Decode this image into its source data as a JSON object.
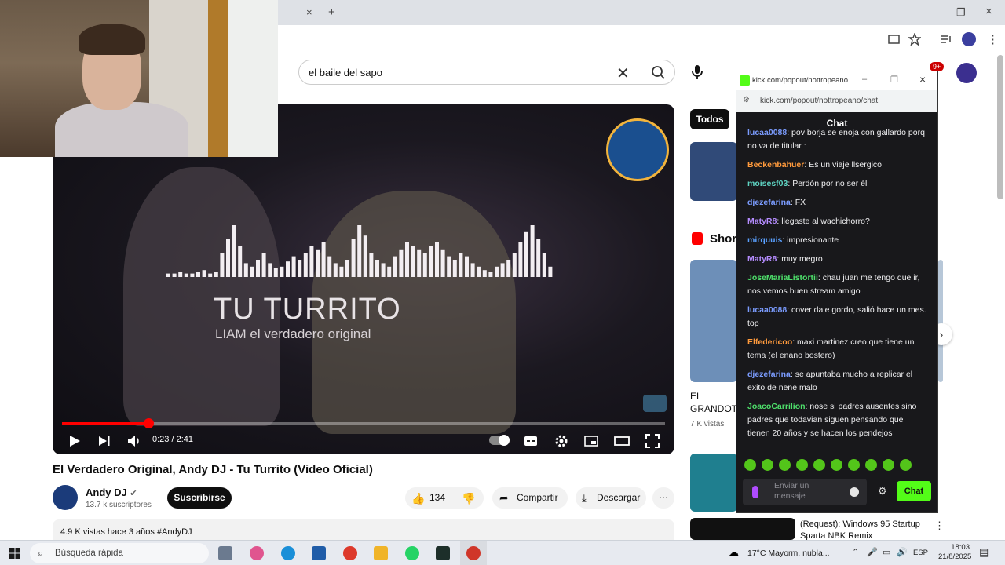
{
  "browser": {
    "tab_close": "×",
    "tab_new": "+",
    "window_min": "–",
    "window_restore": "❐",
    "window_close": "×"
  },
  "youtube": {
    "search": {
      "value": "el baile del sapo"
    },
    "player": {
      "song_title": "TU TURRITO",
      "song_subtitle": "LIAM el verdadero original",
      "time": "0:23 / 2:41",
      "progress": 0.143
    },
    "video": {
      "title": "El Verdadero Original, Andy DJ - Tu Turrito (Video Oficial)",
      "channel": "Andy DJ",
      "subscribers": "13.7 k suscriptores",
      "subscribe_label": "Suscribirse",
      "likes": "134",
      "share_label": "Compartir",
      "download_label": "Descargar",
      "description": "4.9 K vistas  hace 3 años  #AndyDJ"
    },
    "sidebar": {
      "chip_all": "Todos",
      "shorts_label": "Shor",
      "short_title_1": "EL",
      "short_title_2": "GRANDOT",
      "short_views": "7 K vistas",
      "rec_title_1": "(Request): Windows 95 Startup",
      "rec_title_2": "Sparta NBK Remix"
    },
    "notification_count": "9+"
  },
  "chat": {
    "window_title": "kick.com/popout/nottropeano...",
    "url": "kick.com/popout/nottropeano/chat",
    "header": "Chat",
    "messages": [
      {
        "user": "lucaa0088",
        "text": "pov borja se enoja con gallardo porq no va de titular :",
        "color": "#7b9cff"
      },
      {
        "user": "Beckenbahuer",
        "text": "Es un viaje llsergico",
        "color": "#ff9a3c"
      },
      {
        "user": "moisesf03",
        "text": "Perdón por no ser él",
        "color": "#5fd5c4"
      },
      {
        "user": "djezefarina",
        "text": "FX",
        "color": "#7b9cff"
      },
      {
        "user": "MatyR8",
        "text": "llegaste al wachichorro?",
        "color": "#b58cff"
      },
      {
        "user": "mirquuis",
        "text": "impresionante",
        "color": "#5aa0ff"
      },
      {
        "user": "MatyR8",
        "text": "muy megro",
        "color": "#b58cff"
      },
      {
        "user": "JoseMariaListortii",
        "text": "chau juan me tengo que ir, nos vemos buen stream amigo",
        "color": "#4ee06b"
      },
      {
        "user": "lucaa0088",
        "text": "cover dale gordo, salió hace un mes. top",
        "color": "#7b9cff"
      },
      {
        "user": "Elfedericoo",
        "text": "maxi martinez creo que tiene un tema (el enano bostero)",
        "color": "#ff9a3c"
      },
      {
        "user": "djezefarina",
        "text": "se apuntaba mucho a replicar el exito de nene malo",
        "color": "#7b9cff"
      },
      {
        "user": "JoacoCarrilion",
        "text": "nose si padres ausentes sino padres que todavian siguen pensando que tienen 20 años y se hacen los pendejos",
        "color": "#4ee06b"
      }
    ],
    "input_placeholder_1": "Enviar un",
    "input_placeholder_2": "mensaje",
    "send_label": "Chat"
  },
  "taskbar": {
    "search_placeholder": "Búsqueda rápida",
    "weather": "17°C  Mayorm. nubla...",
    "lang": "ESP",
    "time": "18:03",
    "date": "21/8/2025"
  }
}
